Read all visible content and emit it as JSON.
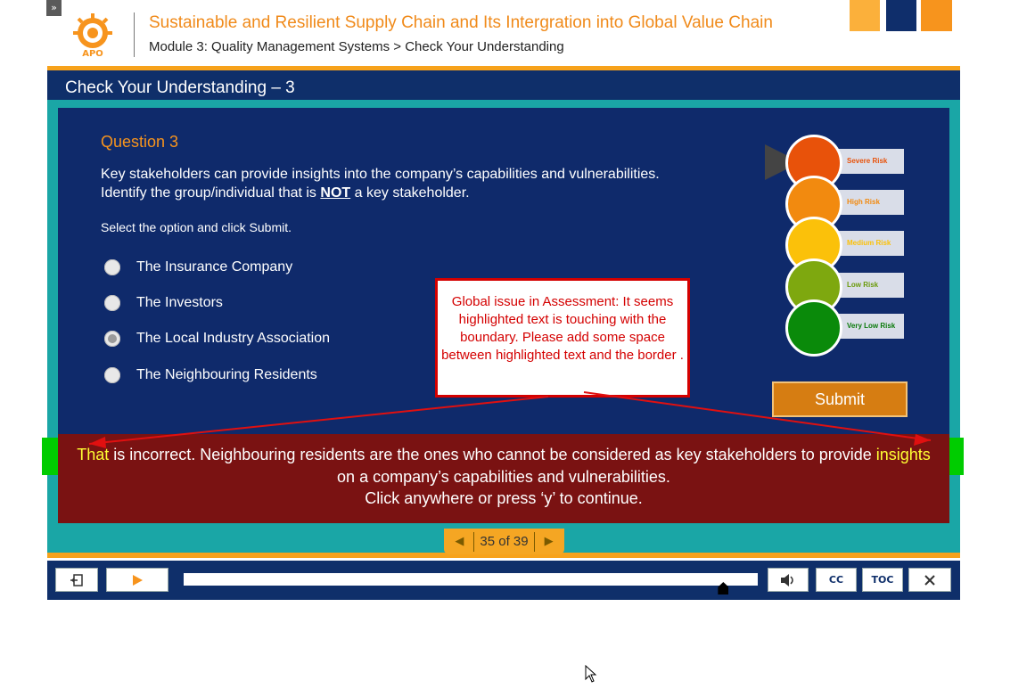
{
  "header": {
    "toggle_label": "»",
    "course_title": "Sustainable and Resilient Supply Chain and Its Intergration into Global Value Chain",
    "breadcrumb": "Module 3: Quality Management Systems > Check Your Understanding",
    "logo_text": "APO",
    "swatch_colors": [
      "#fbb03b",
      "#0f2e6b",
      "#f7941d"
    ]
  },
  "slide": {
    "title": "Check Your Understanding – 3",
    "question_heading": "Question 3",
    "question_text_part1": "Key stakeholders can provide insights into the company’s capabilities and vulnerabilities.",
    "question_text_part2a": "Identify the group/individual that is",
    "question_text_emph": "NOT",
    "question_text_part2b": "a key stakeholder.",
    "instruction": "Select the option and click Submit.",
    "options": [
      {
        "label": "The Insurance Company",
        "selected": false
      },
      {
        "label": "The Investors",
        "selected": false
      },
      {
        "label": "The Local Industry Association",
        "selected": true
      },
      {
        "label": "The Neighbouring Residents",
        "selected": false
      }
    ],
    "submit_label": "Submit",
    "risk_levels": [
      {
        "label": "Severe Risk",
        "color": "#e8520a",
        "text_color": "#e8520a"
      },
      {
        "label": "High Risk",
        "color": "#f28a0f",
        "text_color": "#f28a0f"
      },
      {
        "label": "Medium Risk",
        "color": "#fbc10a",
        "text_color": "#fbc10a"
      },
      {
        "label": "Low Risk",
        "color": "#7ea80f",
        "text_color": "#6a9a0a"
      },
      {
        "label": "Very Low Risk",
        "color": "#0a8a0a",
        "text_color": "#0a7a0a"
      }
    ]
  },
  "feedback": {
    "word_start": "That",
    "line1_middle": " is incorrect. Neighbouring residents are the ones who cannot be considered as key stakeholders to provide ",
    "word_end": "insights",
    "line2": "on a company’s capabilities and vulnerabilities.",
    "line3": "Click anywhere or press ‘y’ to continue."
  },
  "review_comment": {
    "text": "Global issue in Assessment: It seems highlighted text is touching with the boundary. Please add some space between highlighted text and the border ."
  },
  "pager": {
    "label": "35 of 39",
    "current": 35,
    "total": 39
  },
  "controls": {
    "exit_icon": "exit-icon",
    "play_icon": "play-icon",
    "volume_icon": "volume-icon",
    "cc_label": "CC",
    "toc_label": "TOC",
    "close_icon": "close-icon",
    "progress_fraction": 0.94
  }
}
